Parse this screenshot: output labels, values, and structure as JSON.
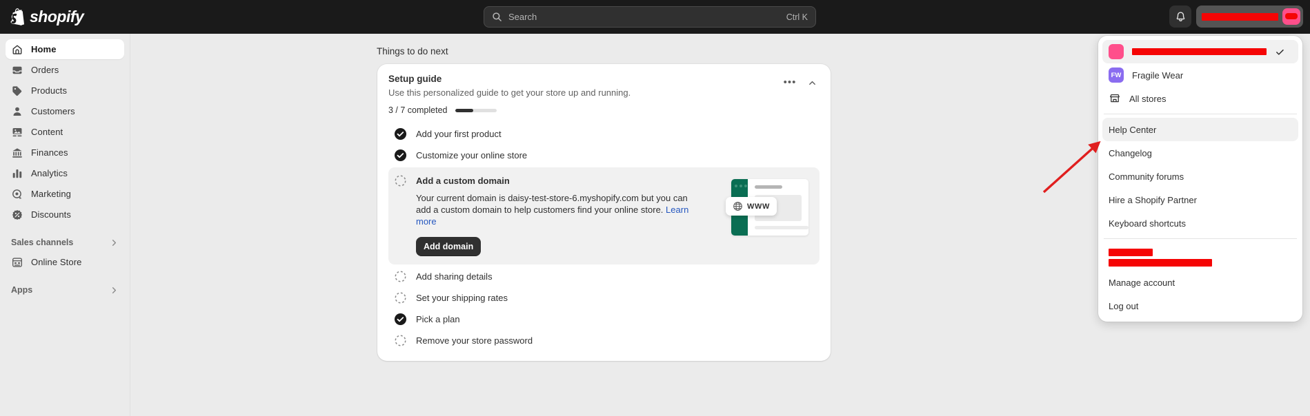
{
  "topbar": {
    "brand": "shopify",
    "logo_icon": "shopify-bag-icon",
    "search": {
      "placeholder": "Search",
      "shortcut": "Ctrl K",
      "icon": "search-icon"
    },
    "notifications_icon": "bell-icon",
    "user_menu": {
      "redacted": true,
      "avatar_icon": "store-avatar"
    }
  },
  "sidebar": {
    "items": [
      {
        "label": "Home",
        "icon": "home-icon",
        "active": true
      },
      {
        "label": "Orders",
        "icon": "orders-inbox-icon",
        "active": false
      },
      {
        "label": "Products",
        "icon": "product-tag-icon",
        "active": false
      },
      {
        "label": "Customers",
        "icon": "person-icon",
        "active": false
      },
      {
        "label": "Content",
        "icon": "content-image-icon",
        "active": false
      },
      {
        "label": "Finances",
        "icon": "bank-icon",
        "active": false
      },
      {
        "label": "Analytics",
        "icon": "bar-chart-icon",
        "active": false
      },
      {
        "label": "Marketing",
        "icon": "megaphone-target-icon",
        "active": false
      },
      {
        "label": "Discounts",
        "icon": "discount-percent-icon",
        "active": false
      }
    ],
    "sales_channels": {
      "title": "Sales channels",
      "chevron_icon": "chevron-right-icon",
      "items": [
        {
          "label": "Online Store",
          "icon": "storefront-icon"
        }
      ]
    },
    "apps": {
      "title": "Apps",
      "chevron_icon": "chevron-right-icon"
    }
  },
  "main": {
    "page_heading": "Things to do next",
    "setup_guide": {
      "title": "Setup guide",
      "subtitle": "Use this personalized guide to get your store up and running.",
      "more_icon": "ellipsis-icon",
      "collapse_icon": "chevron-up-icon",
      "progress_label": "3 / 7 completed",
      "completed": 3,
      "total": 7,
      "tasks": [
        {
          "label": "Add your first product",
          "done": true,
          "expanded": false
        },
        {
          "label": "Customize your online store",
          "done": true,
          "expanded": false
        },
        {
          "label": "Add a custom domain",
          "done": false,
          "expanded": true,
          "description": "Your current domain is daisy-test-store-6.myshopify.com but you can add a custom domain to help customers find your online store.",
          "link_label": "Learn more",
          "button_label": "Add domain",
          "illustration": {
            "chip_label": "WWW",
            "chip_icon": "globe-icon"
          }
        },
        {
          "label": "Add sharing details",
          "done": false,
          "expanded": false
        },
        {
          "label": "Set your shipping rates",
          "done": false,
          "expanded": false
        },
        {
          "label": "Pick a plan",
          "done": true,
          "expanded": false
        },
        {
          "label": "Remove your store password",
          "done": false,
          "expanded": false
        }
      ]
    }
  },
  "dropdown": {
    "stores": [
      {
        "label": "",
        "redacted": true,
        "selected": true,
        "avatar_color": "#ff4f8b",
        "initials": "",
        "check_icon": "check-icon"
      },
      {
        "label": "Fragile Wear",
        "redacted": false,
        "selected": false,
        "avatar_color": "#8a6cf0",
        "initials": "FW"
      }
    ],
    "all_stores": {
      "label": "All stores",
      "icon": "storefront-icon"
    },
    "links": [
      {
        "label": "Help Center",
        "hover": true
      },
      {
        "label": "Changelog",
        "hover": false
      },
      {
        "label": "Community forums",
        "hover": false
      },
      {
        "label": "Hire a Shopify Partner",
        "hover": false
      },
      {
        "label": "Keyboard shortcuts",
        "hover": false
      }
    ],
    "account": {
      "redacted": true
    },
    "account_links": [
      {
        "label": "Manage account"
      },
      {
        "label": "Log out"
      }
    ]
  },
  "annotation": {
    "type": "arrow",
    "color": "#e01f1f",
    "points_to": "Help Center"
  }
}
